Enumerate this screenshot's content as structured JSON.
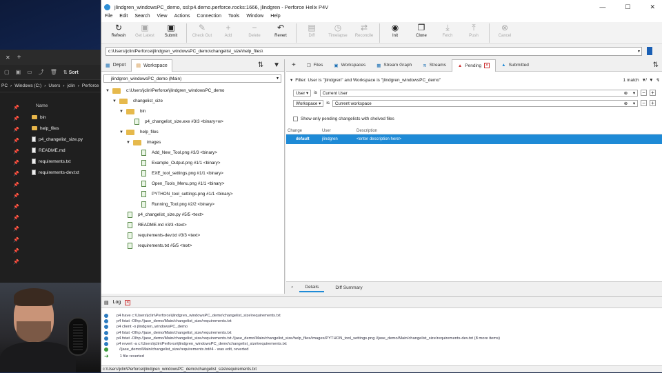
{
  "window": {
    "title": "jlindgren_windowsPC_demo,  ssl:p4.demo.perforce.rocks:1666,  jlindgren - Perforce Helix P4V"
  },
  "menu": [
    "File",
    "Edit",
    "Search",
    "View",
    "Actions",
    "Connection",
    "Tools",
    "Window",
    "Help"
  ],
  "toolbar": [
    {
      "label": "Refresh",
      "icon": "↻",
      "enabled": true
    },
    {
      "label": "Get Latest",
      "icon": "▣",
      "enabled": false
    },
    {
      "label": "Submit",
      "icon": "▣",
      "enabled": true
    },
    {
      "label": "Check Out",
      "icon": "✎",
      "enabled": false
    },
    {
      "label": "Add",
      "icon": "+",
      "enabled": false
    },
    {
      "label": "Delete",
      "icon": "−",
      "enabled": false
    },
    {
      "label": "Revert",
      "icon": "↶",
      "enabled": true
    },
    {
      "label": "Diff",
      "icon": "▤",
      "enabled": false
    },
    {
      "label": "Timelapse",
      "icon": "◷",
      "enabled": false
    },
    {
      "label": "Reconcile",
      "icon": "⇄",
      "enabled": false
    },
    {
      "label": "Init",
      "icon": "◉",
      "enabled": true
    },
    {
      "label": "Clone",
      "icon": "❐",
      "enabled": true
    },
    {
      "label": "Fetch",
      "icon": "⤓",
      "enabled": false
    },
    {
      "label": "Push",
      "icon": "⤒",
      "enabled": false
    },
    {
      "label": "Cancel",
      "icon": "⊗",
      "enabled": false
    }
  ],
  "address": "c:\\Users\\jclin\\Perforce\\jlindgren_windowsPC_demo\\changelist_size\\help_files\\",
  "left_tabs": {
    "depot": "Depot",
    "workspace": "Workspace"
  },
  "workspace_select": "jlindgren_windowsPC_demo (Main)",
  "tree": [
    {
      "label": "c:\\Users\\jclin\\Perforce\\jlindgren_windowsPC_demo",
      "kind": "folder",
      "depth": 0
    },
    {
      "label": "changelist_size",
      "kind": "folder",
      "depth": 1
    },
    {
      "label": "bin",
      "kind": "folder",
      "depth": 2
    },
    {
      "label": "p4_changelist_size.exe #3/3 <binary+w>",
      "kind": "file",
      "depth": 3
    },
    {
      "label": "help_files",
      "kind": "folder",
      "depth": 2
    },
    {
      "label": "images",
      "kind": "folder",
      "depth": 3
    },
    {
      "label": "Add_New_Tool.png #3/3 <binary>",
      "kind": "file",
      "depth": 4
    },
    {
      "label": "Example_Output.png #1/1 <binary>",
      "kind": "file",
      "depth": 4
    },
    {
      "label": "EXE_tool_settings.png #1/1 <binary>",
      "kind": "file",
      "depth": 4
    },
    {
      "label": "Open_Tools_Menu.png #1/1 <binary>",
      "kind": "file",
      "depth": 4
    },
    {
      "label": "PYTHON_tool_settings.png #1/1 <binary>",
      "kind": "file",
      "depth": 4
    },
    {
      "label": "Running_Tool.png #2/2 <binary>",
      "kind": "file",
      "depth": 4
    },
    {
      "label": "p4_changelist_size.py #5/5 <text>",
      "kind": "file",
      "depth": 2
    },
    {
      "label": "README.md #3/3 <text>",
      "kind": "file",
      "depth": 2
    },
    {
      "label": "requirements-dev.txt #3/3 <text>",
      "kind": "file",
      "depth": 2
    },
    {
      "label": "requirements.txt #5/5 <text>",
      "kind": "file",
      "depth": 2
    }
  ],
  "right_tabs": [
    "Files",
    "Workspaces",
    "Stream Graph",
    "Streams",
    "Pending",
    "Submitted"
  ],
  "filter": {
    "text": "Filter: User is \"jlindgren\" and Workspace is \"jlindgren_windowsPC_demo\"",
    "count": "1 match"
  },
  "filter_rows": [
    {
      "field": "User",
      "op": "is",
      "value": "Current User"
    },
    {
      "field": "Workspace",
      "op": "is",
      "value": "Current workspace"
    }
  ],
  "shelved_label": "Show only pending changelists with shelved files",
  "cl_headers": {
    "change": "Change",
    "user": "User",
    "description": "Description"
  },
  "cl_row": {
    "change": "default",
    "user": "jlindgren",
    "description": "<enter description here>"
  },
  "detail_tabs": {
    "details": "Details",
    "diff": "Diff Summary"
  },
  "log_title": "Log",
  "log_lines": [
    "p4 have c:\\Users\\jclin\\Perforce\\jlindgren_windowsPC_demo\\changelist_size\\requirements.txt",
    "p4 fstat -Olhp //jase_demo/Main/changelist_size/requirements.txt",
    "p4 client -o jlindgren_windowsPC_demo",
    "p4 fstat -Olhp //jase_demo/Main/changelist_size/requirements.txt",
    "p4 fstat -Olhp //jase_demo/Main/changelist_size/requirements.txt //jase_demo/Main/changelist_size/help_files/images/PYTHON_tool_settings.png //jase_demo/Main/changelist_size/requirements-dev.txt (8 more items)",
    "p4 revert -a c:\\Users\\jclin\\Perforce\\jlindgren_windowsPC_demo\\changelist_size\\requirements.txt",
    "//jase_demo/Main/changelist_size/requirements.txt#4 - was edit, reverted",
    "1 file reverted"
  ],
  "status_text": "c:\\Users\\jclin\\Perforce\\jlindgren_windowsPC_demo\\changelist_size\\requirements.txt",
  "explorer": {
    "path": [
      "PC",
      "Windows (C:)",
      "Users",
      "jclin",
      "Perforce"
    ],
    "sort_label": "Sort",
    "name_header": "Name",
    "files": [
      "bin",
      "help_files",
      "p4_changelist_size.py",
      "README.md",
      "requirements.txt",
      "requirements-dev.txt"
    ]
  }
}
